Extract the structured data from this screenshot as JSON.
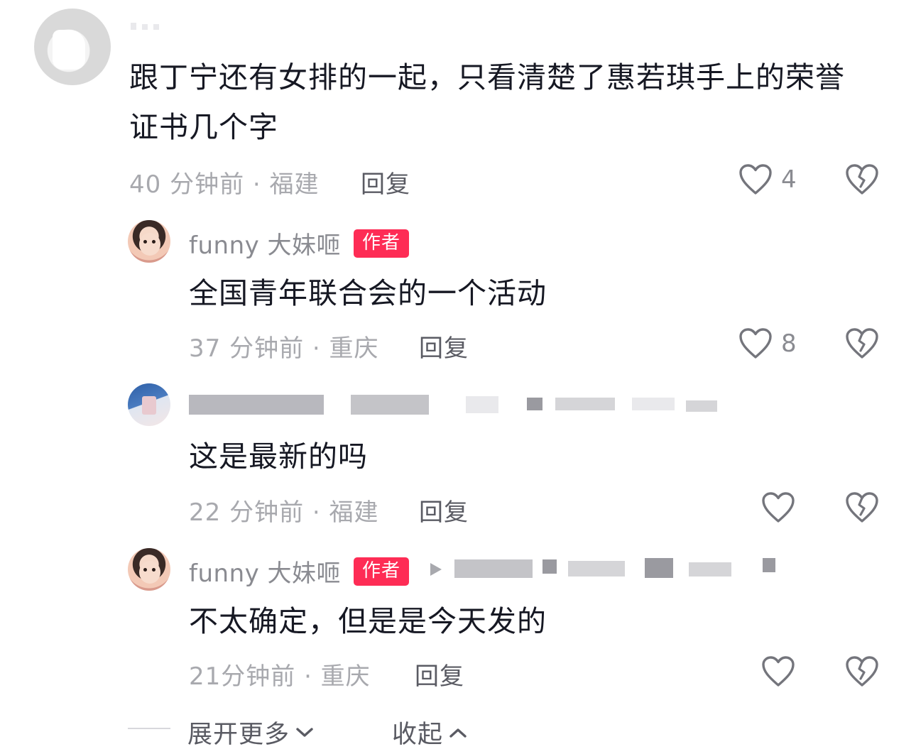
{
  "comments": [
    {
      "username": "",
      "text_line1": "跟丁宁还有女排的一起，只看清楚了惠若琪手上的荣誉",
      "text_line2": "证书几个字",
      "meta": "40 分钟前 · 福建",
      "reply_label": "回复",
      "likes": "4"
    }
  ],
  "replies": [
    {
      "username": "funny 大妹咂",
      "author_tag": "作者",
      "text": "全国青年联合会的一个活动",
      "meta": "37 分钟前 · 重庆",
      "reply_label": "回复",
      "likes": "8"
    },
    {
      "username": "",
      "text": "这是最新的吗",
      "meta": "22 分钟前 · 福建",
      "reply_label": "回复",
      "likes": ""
    },
    {
      "username": "funny 大妹咂",
      "author_tag": "作者",
      "text": "不太确定，但是是今天发的",
      "meta": "21分钟前 · 重庆",
      "reply_label": "回复",
      "likes": ""
    }
  ],
  "footer": {
    "expand_label": "展开更多",
    "collapse_label": "收起"
  },
  "colors": {
    "author_tag": "#fe2c55",
    "meta_text": "#a8a9ae",
    "body_text": "#161823"
  },
  "icons": {
    "like": "heart-outline-icon",
    "dislike": "broken-heart-icon",
    "expand": "chevron-down-icon",
    "collapse": "chevron-up-icon",
    "reply_arrow": "triangle-right-icon"
  }
}
